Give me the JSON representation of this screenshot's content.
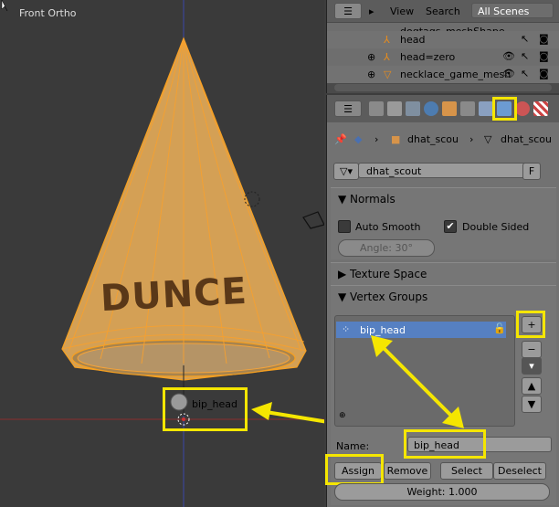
{
  "viewport": {
    "title": "Front Ortho",
    "mesh_text": "DUNCE",
    "bone_label": "bip_head",
    "cone_color": "#e0a040"
  },
  "outliner": {
    "view_menu": "View",
    "search_menu": "Search",
    "scenes_dropdown": "All Scenes",
    "rows": [
      {
        "label": "dogtags_meshShape"
      },
      {
        "label": "head"
      },
      {
        "label": "head=zero"
      },
      {
        "label": "necklace_game_mesh"
      }
    ]
  },
  "properties": {
    "breadcrumb_1": "dhat_scou",
    "breadcrumb_2": "dhat_scou",
    "mesh_name": "dhat_scout",
    "fake_user": "F",
    "normals": {
      "title": "Normals",
      "auto_smooth": "Auto Smooth",
      "double_sided": "Double Sided",
      "angle": "Angle: 30°"
    },
    "texture_space": {
      "title": "Texture Space"
    },
    "vertex_groups": {
      "title": "Vertex Groups",
      "items": [
        {
          "name": "bip_head"
        }
      ],
      "name_label": "Name:",
      "name_value": "bip_head",
      "assign": "Assign",
      "remove": "Remove",
      "select": "Select",
      "deselect": "Deselect",
      "weight": "Weight: 1.000"
    }
  },
  "colors": {
    "highlight": "#f5e600",
    "selected_row": "#5680c2"
  }
}
